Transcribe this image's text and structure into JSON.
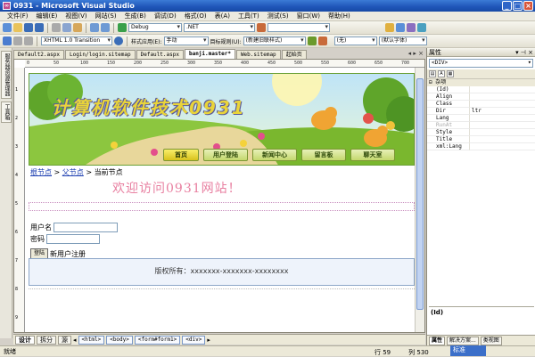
{
  "window": {
    "title": "0931 - Microsoft Visual Studio",
    "minimize": "_",
    "maximize": "□",
    "close": "×"
  },
  "menu": [
    "文件(F)",
    "编辑(E)",
    "视图(V)",
    "网站(S)",
    "生成(B)",
    "调试(D)",
    "格式(O)",
    "表(A)",
    "工具(T)",
    "测试(S)",
    "窗口(W)",
    "帮助(H)"
  ],
  "toolbar1": {
    "config": "Debug",
    "platform": ".NET"
  },
  "toolbar2": {
    "doctype": "XHTML 1.0 Transition",
    "style_app": "样式应用(E):",
    "style_mode": "手动",
    "target_rule": "目标规则(U):",
    "new_style": "(新建旧联样式)",
    "none": "(无)",
    "font": "(默认字体)"
  },
  "left_strip": [
    "服务器资源管理器",
    "工具箱"
  ],
  "tabs": [
    "Default2.aspx",
    "Login/login.sitemap",
    "Default.aspx",
    "banji.master*",
    "Web.sitemap",
    "起始页"
  ],
  "active_tab": "banji.master*",
  "ruler_h": [
    "0",
    "50",
    "100",
    "150",
    "200",
    "250",
    "300",
    "350",
    "400",
    "450",
    "500",
    "550",
    "600",
    "650",
    "700"
  ],
  "ruler_v": [
    "1",
    "2",
    "3",
    "4",
    "5",
    "6",
    "7",
    "8",
    "9"
  ],
  "banner": {
    "title": "计算机软件技术0931",
    "nav": [
      "首页",
      "用户登陆",
      "新闻中心",
      "留言板",
      "聊天室"
    ]
  },
  "breadcrumb": {
    "root": "根节点",
    "sep": " > ",
    "parent": "父节点",
    "current": "当前节点"
  },
  "welcome": "欢迎访问0931网站！",
  "login": {
    "user_label": "用户名",
    "pwd_label": "密码",
    "login_button": "登陆",
    "register_link": "新用户注册"
  },
  "footer": {
    "text": "版权所有：xxxxxxx-xxxxxxx-xxxxxxxx"
  },
  "view_buttons": [
    "设计",
    "拆分",
    "源"
  ],
  "tag_path": [
    "<html>",
    "<body>",
    "<form#form1>",
    "<div>"
  ],
  "status": {
    "left": "就绪",
    "col_label": "行 59",
    "row_label": "列 530",
    "task": "标准"
  },
  "properties_panel": {
    "title": "属性",
    "selected": "<DIV>",
    "category": "杂项",
    "rows": [
      {
        "name": "(Id)",
        "value": "",
        "disabled": false
      },
      {
        "name": "Align",
        "value": "",
        "disabled": false
      },
      {
        "name": "Class",
        "value": "",
        "disabled": false
      },
      {
        "name": "Dir",
        "value": "ltr",
        "disabled": false
      },
      {
        "name": "Lang",
        "value": "",
        "disabled": false
      },
      {
        "name": "RunAt",
        "value": "",
        "disabled": true
      },
      {
        "name": "Style",
        "value": "",
        "disabled": false
      },
      {
        "name": "Title",
        "value": "",
        "disabled": false
      },
      {
        "name": "xml:Lang",
        "value": "",
        "disabled": false
      }
    ],
    "desc_title": "(Id)",
    "bottom_tabs": [
      "属性",
      "解决方案...",
      "类视图"
    ]
  }
}
